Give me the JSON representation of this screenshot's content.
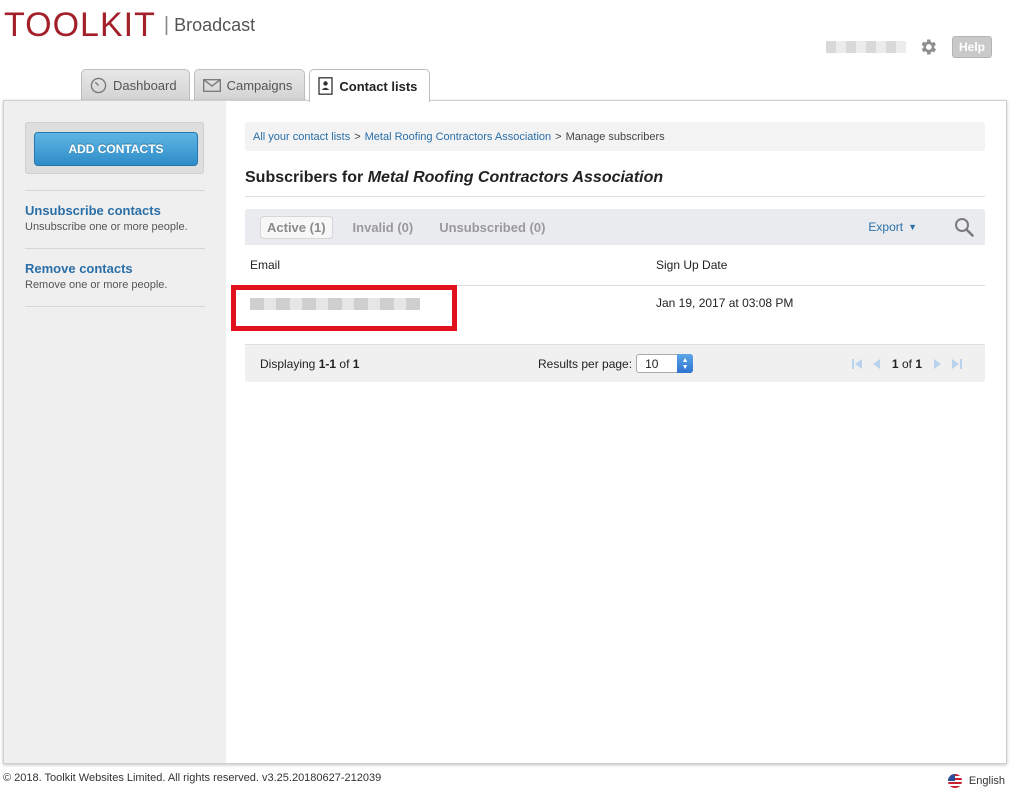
{
  "header": {
    "logo": "TOOLKIT",
    "separator": "|",
    "product": "Broadcast",
    "help_label": "Help"
  },
  "tabs": [
    {
      "label": "Dashboard",
      "icon": "gauge-icon"
    },
    {
      "label": "Campaigns",
      "icon": "envelope-icon"
    },
    {
      "label": "Contact lists",
      "icon": "contact-book-icon",
      "active": true
    }
  ],
  "sidebar": {
    "add_contacts_label": "ADD CONTACTS",
    "unsubscribe": {
      "title": "Unsubscribe contacts",
      "desc": "Unsubscribe one or more people."
    },
    "remove": {
      "title": "Remove contacts",
      "desc": "Remove one or more people."
    }
  },
  "breadcrumb": {
    "items": [
      "All your contact lists",
      "Metal Roofing Contractors Association",
      "Manage subscribers"
    ],
    "separator": ">"
  },
  "page": {
    "title_prefix": "Subscribers for",
    "list_name": "Metal Roofing Contractors Association"
  },
  "filters": {
    "active": "Active (1)",
    "invalid": "Invalid (0)",
    "unsubscribed": "Unsubscribed (0)",
    "export_label": "Export",
    "export_caret": "▼"
  },
  "table": {
    "headers": {
      "email": "Email",
      "signup": "Sign Up Date"
    },
    "rows": [
      {
        "signup": "Jan 19, 2017 at 03:08 PM"
      }
    ]
  },
  "pager": {
    "displaying_prefix": "Displaying",
    "range": "1-1",
    "of_word": "of",
    "total": "1",
    "results_label": "Results per page:",
    "per_page": "10",
    "page_text_current": "1",
    "page_text_of": "of",
    "page_text_total": "1"
  },
  "footer": {
    "copyright": "© 2018. Toolkit Websites Limited. All rights reserved. v3.25.20180627-212039",
    "language": "English"
  },
  "colors": {
    "brand": "#a3202a",
    "link": "#2a6fa8",
    "primary_button": "#2f8cc8",
    "highlight": "#e0111a"
  }
}
